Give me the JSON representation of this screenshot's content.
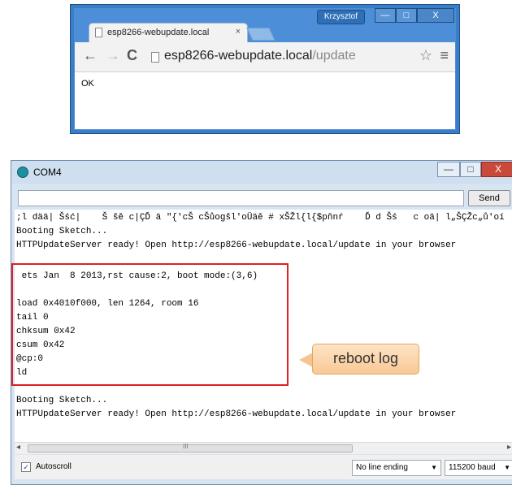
{
  "browser": {
    "user_name": "Krzysztof",
    "window_buttons": {
      "minimize": "—",
      "maximize": "□",
      "close": "X"
    },
    "tab": {
      "title": "esp8266-webupdate.local",
      "close": "×"
    },
    "nav": {
      "back": "←",
      "forward": "→",
      "reload": "C"
    },
    "address": {
      "host": "esp8266-webupdate.local",
      "path": "/update"
    },
    "star": "☆",
    "menu": "≡",
    "content": {
      "text": "OK"
    }
  },
  "serial": {
    "title": "COM4",
    "window_buttons": {
      "minimize": "—",
      "maximize": "□",
      "close": "X"
    },
    "send_label": "Send",
    "input_value": "",
    "output_lines": [
      ";l dää| Šść|    Š šě c|ÇĎ ä \"{'cŠ cŠůogšl'oÜäě # xŠŽl{l{$pňnŕ    Ď d Šś   c oä| l„ŠÇŽc„ů'oí",
      "Booting Sketch...",
      "HTTPUpdateServer ready! Open http://esp8266-webupdate.local/update in your browser",
      "",
      " ets Jan  8 2013,rst cause:2, boot mode:(3,6)",
      "",
      "load 0x4010f000, len 1264, room 16",
      "tail 0",
      "chksum 0x42",
      "csum 0x42",
      "@cp:0",
      "ld",
      "",
      "Booting Sketch...",
      "HTTPUpdateServer ready! Open http://esp8266-webupdate.local/update in your browser"
    ],
    "scroll": {
      "left": "◂",
      "right": "▸",
      "grip": "III"
    },
    "autoscroll": {
      "label": "Autoscroll",
      "checked": true,
      "mark": "✓"
    },
    "line_ending": "No line ending",
    "baud": "115200 baud",
    "dropdown_arrow": "▼"
  },
  "callout": {
    "text": "reboot log"
  },
  "colors": {
    "highlight": "#e02020",
    "callout_fill": "#f9c896",
    "window_blue": "#3a7ec8"
  }
}
